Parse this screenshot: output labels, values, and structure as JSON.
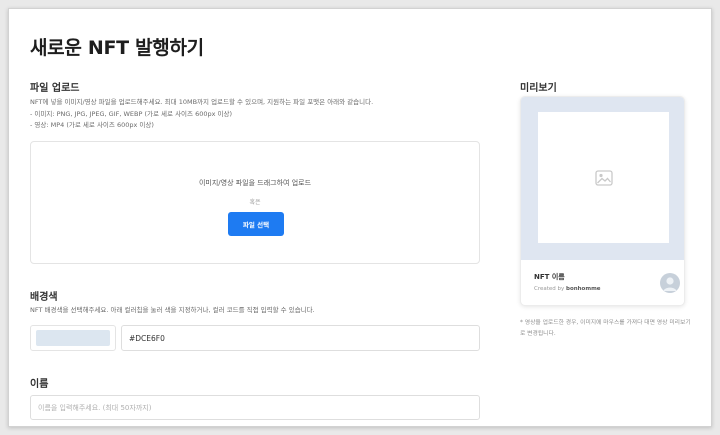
{
  "page": {
    "title": "새로운 NFT 발행하기"
  },
  "upload": {
    "section_title": "파일 업로드",
    "desc_line1": "NFT에 넣을 이미지/영상 파일을 업로드해주세요. 최대 10MB까지 업로드할 수 있으며, 지원하는 파일 포맷은 아래와 같습니다.",
    "desc_line2": "- 이미지: PNG, JPG, JPEG, GIF, WEBP (가로 세로 사이즈 600px 이상)",
    "desc_line3": "- 영상: MP4 (가로 세로 사이즈 600px 이상)",
    "drop_text": "이미지/영상 파일을 드래그하여 업로드",
    "or_text": "혹은",
    "select_button": "파일 선택"
  },
  "background": {
    "section_title": "배경색",
    "desc": "NFT 배경색을 선택해주세요. 아래 컬러칩을 눌러 색을 지정하거나, 컬러 코드를 직접 입력할 수 있습니다.",
    "value": "#DCE6F0",
    "swatch_color": "#DCE6F0"
  },
  "name": {
    "section_title": "이름",
    "placeholder": "이름을 입력해주세요. (최대 50자까지)"
  },
  "preview": {
    "section_title": "미리보기",
    "card_name": "NFT 이름",
    "created_by_label": "Created by",
    "creator": "bonhomme",
    "note": "* 영상을 업로드한 경우, 이미지에 마우스를 가져다 대면 영상 미리보기로 변경됩니다."
  },
  "colors": {
    "accent": "#1E7BF2",
    "preview_bg": "#DFE6F1"
  }
}
